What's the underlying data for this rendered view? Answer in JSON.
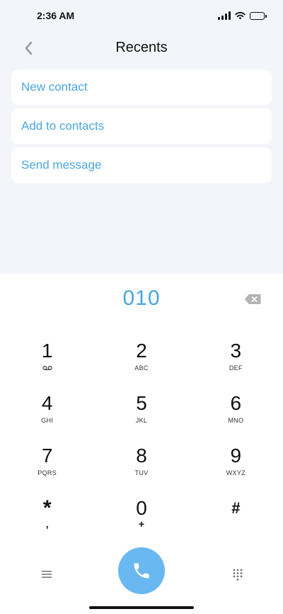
{
  "status_bar": {
    "time": "2:36 AM"
  },
  "header": {
    "title": "Recents"
  },
  "actions": [
    {
      "label": "New contact"
    },
    {
      "label": "Add to contacts"
    },
    {
      "label": "Send message"
    }
  ],
  "dialpad": {
    "number": "010",
    "keys": [
      {
        "digit": "1",
        "letters": ""
      },
      {
        "digit": "2",
        "letters": "ABC"
      },
      {
        "digit": "3",
        "letters": "DEF"
      },
      {
        "digit": "4",
        "letters": "GHI"
      },
      {
        "digit": "5",
        "letters": "JKL"
      },
      {
        "digit": "6",
        "letters": "MNO"
      },
      {
        "digit": "7",
        "letters": "PQRS"
      },
      {
        "digit": "8",
        "letters": "TUV"
      },
      {
        "digit": "9",
        "letters": "WXYZ"
      },
      {
        "digit": "*",
        "letters": ","
      },
      {
        "digit": "0",
        "letters": "+"
      },
      {
        "digit": "#",
        "letters": ""
      }
    ]
  },
  "colors": {
    "accent": "#4aa7dd",
    "call_button": "#6ab8f2",
    "background": "#f4f5fa"
  },
  "icons": {
    "back": "chevron-left-icon",
    "backspace": "backspace-icon",
    "voicemail": "voicemail-icon",
    "menu": "menu-icon",
    "call": "phone-icon",
    "keypad": "keypad-icon"
  }
}
